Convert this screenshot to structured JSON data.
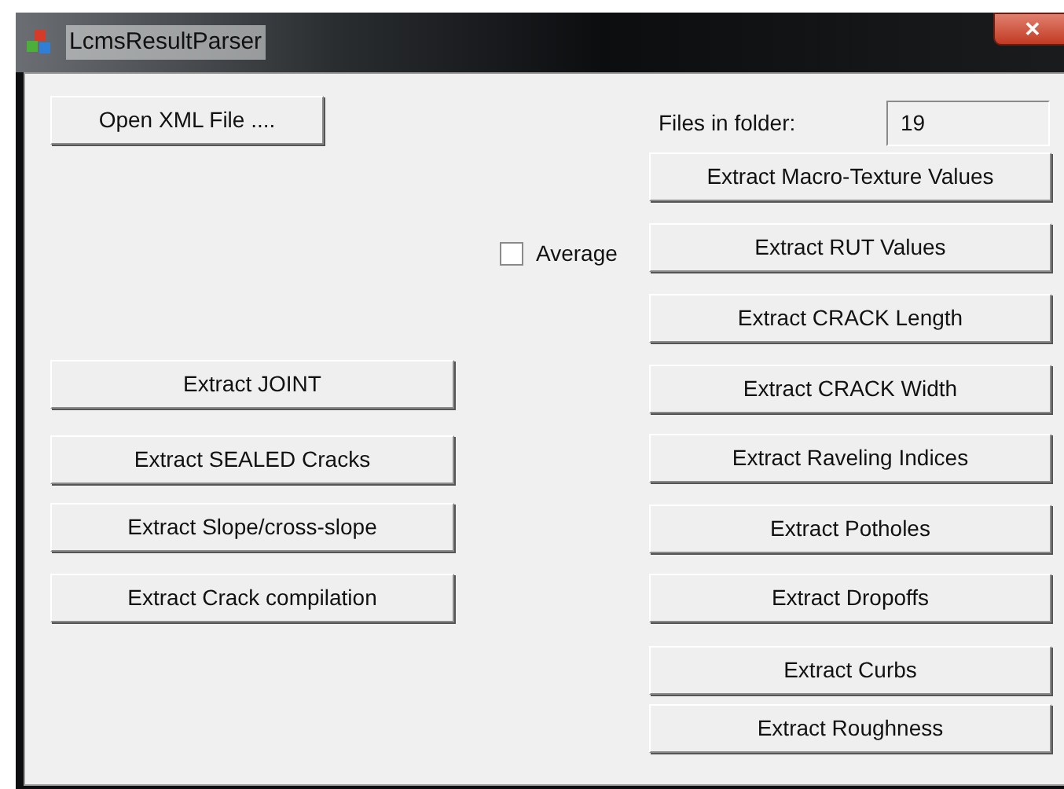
{
  "window": {
    "title": "LcmsResultParser",
    "close": "✕"
  },
  "open_button": "Open XML File ....",
  "files_in_folder": {
    "label": "Files in folder:",
    "value": "19"
  },
  "average": {
    "label": "Average",
    "checked": false
  },
  "left_buttons": [
    "Extract JOINT",
    "Extract SEALED Cracks",
    "Extract Slope/cross-slope",
    "Extract Crack compilation"
  ],
  "right_buttons": [
    "Extract Macro-Texture Values",
    "Extract RUT Values",
    "Extract CRACK Length",
    "Extract CRACK Width",
    "Extract Raveling Indices",
    "Extract Potholes",
    "Extract Dropoffs",
    "Extract Curbs",
    "Extract Roughness"
  ]
}
